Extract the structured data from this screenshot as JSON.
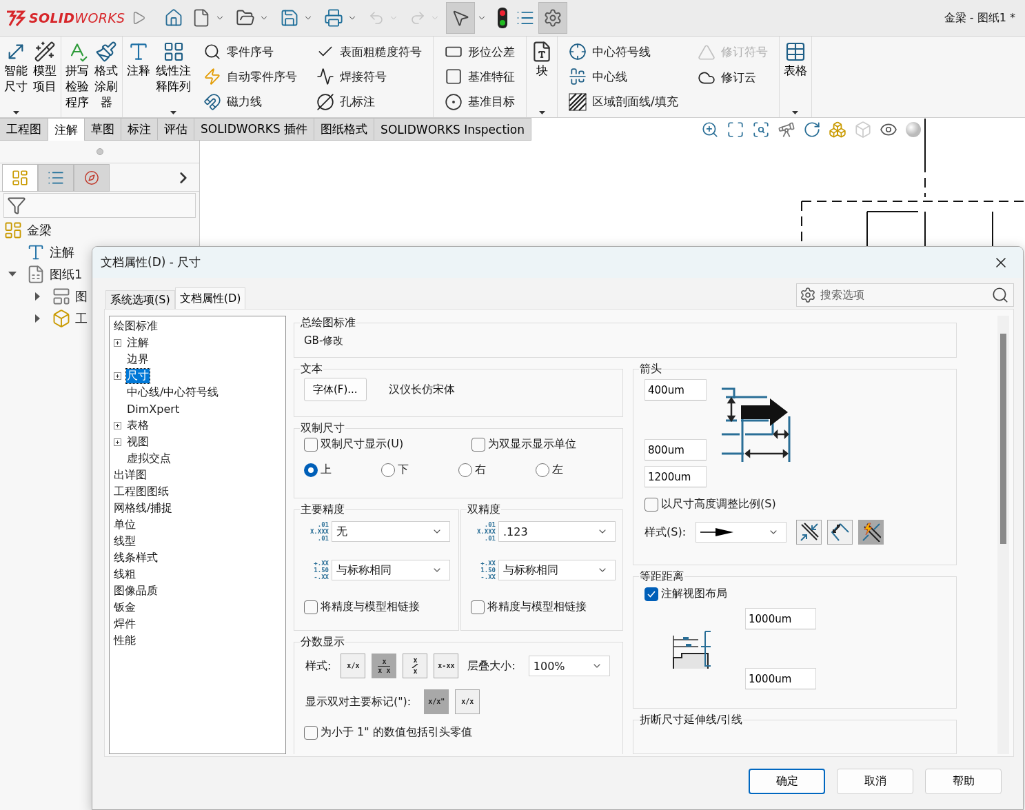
{
  "app": {
    "logo": "**SOLID**WORKS",
    "title": "金梁 - 图纸1 *"
  },
  "ribbon": [
    {
      "columns": [
        {
          "kind": "big",
          "label": "智能尺寸",
          "dropdown": true
        },
        {
          "kind": "big",
          "label": "模型项目",
          "dropdown": false
        }
      ]
    },
    {
      "columns": [
        {
          "kind": "big",
          "label": "拼写检验程序",
          "dropdown": false
        },
        {
          "kind": "big",
          "label": "格式涂刷器",
          "dropdown": false
        }
      ]
    },
    {
      "columns": [
        {
          "kind": "big",
          "label": "注释",
          "dropdown": false
        },
        {
          "kind": "big",
          "label": "线性注释阵列",
          "dropdown": true
        },
        {
          "kind": "stack",
          "items": [
            {
              "label": "零件序号",
              "disabled": false
            },
            {
              "label": "自动零件序号",
              "disabled": false
            },
            {
              "label": "磁力线",
              "disabled": false
            }
          ]
        },
        {
          "kind": "stack",
          "items": [
            {
              "label": "表面粗糙度符号",
              "disabled": false
            },
            {
              "label": "焊接符号",
              "disabled": false
            },
            {
              "label": "孔标注",
              "disabled": false
            }
          ]
        }
      ]
    },
    {
      "columns": [
        {
          "kind": "stack",
          "items": [
            {
              "label": "形位公差",
              "disabled": false
            },
            {
              "label": "基准特征",
              "disabled": false
            },
            {
              "label": "基准目标",
              "disabled": false
            }
          ]
        }
      ]
    },
    {
      "columns": [
        {
          "kind": "big",
          "label": "块",
          "dropdown": true
        }
      ]
    },
    {
      "columns": [
        {
          "kind": "stack",
          "items": [
            {
              "label": "中心符号线",
              "disabled": false
            },
            {
              "label": "中心线",
              "disabled": false
            },
            {
              "label": "区域剖面线/填充",
              "disabled": false
            }
          ]
        },
        {
          "kind": "stack",
          "items": [
            {
              "label": "修订符号",
              "disabled": true
            },
            {
              "label": "修订云",
              "disabled": false
            }
          ]
        }
      ]
    },
    {
      "columns": [
        {
          "kind": "big",
          "label": "表格",
          "dropdown": true
        }
      ]
    }
  ],
  "tabs": [
    {
      "label": "工程图",
      "selected": false
    },
    {
      "label": "注解",
      "selected": true
    },
    {
      "label": "草图",
      "selected": false
    },
    {
      "label": "标注",
      "selected": false
    },
    {
      "label": "评估",
      "selected": false
    },
    {
      "label": "SOLIDWORKS 插件",
      "selected": false
    },
    {
      "label": "图纸格式",
      "selected": false
    },
    {
      "label": "SOLIDWORKS Inspection",
      "selected": false
    }
  ],
  "panel_tabs": [
    {
      "selected": true
    },
    {
      "selected": false
    },
    {
      "selected": false
    }
  ],
  "feature_tree": [
    {
      "label": "金梁",
      "toggle": false,
      "children": [
        {
          "label": "注解",
          "toggle": false
        },
        {
          "label": "图纸1",
          "toggle": true,
          "expanded": true,
          "children": [
            {
              "label": "图",
              "toggle": true,
              "expanded": false
            },
            {
              "label": "工",
              "toggle": true,
              "expanded": false
            }
          ]
        }
      ]
    }
  ],
  "dialog": {
    "title": "文档属性(D) - 尺寸",
    "tabs": [
      {
        "label": "系统选项(S)",
        "selected": false
      },
      {
        "label": "文档属性(D)",
        "selected": true
      }
    ],
    "search": {
      "placeholder": "搜索选项"
    },
    "tree": [
      {
        "label": "绘图标准",
        "collapsed": false,
        "selected": false,
        "children": [
          {
            "label": "注解",
            "collapsed": true,
            "selected": false
          },
          {
            "label": "边界",
            "collapsed": false,
            "selected": false
          },
          {
            "label": "尺寸",
            "collapsed": true,
            "selected": true
          },
          {
            "label": "中心线/中心符号线",
            "collapsed": false,
            "selected": false
          },
          {
            "label": "DimXpert",
            "collapsed": false,
            "selected": false
          },
          {
            "label": "表格",
            "collapsed": true,
            "selected": false
          },
          {
            "label": "视图",
            "collapsed": true,
            "selected": false
          },
          {
            "label": "虚拟交点",
            "collapsed": false,
            "selected": false
          }
        ]
      },
      {
        "label": "出详图",
        "collapsed": false,
        "selected": false
      },
      {
        "label": "工程图图纸",
        "collapsed": false,
        "selected": false
      },
      {
        "label": "网格线/捕捉",
        "collapsed": false,
        "selected": false
      },
      {
        "label": "单位",
        "collapsed": false,
        "selected": false
      },
      {
        "label": "线型",
        "collapsed": false,
        "selected": false
      },
      {
        "label": "线条样式",
        "collapsed": false,
        "selected": false
      },
      {
        "label": "线粗",
        "collapsed": false,
        "selected": false
      },
      {
        "label": "图像品质",
        "collapsed": false,
        "selected": false
      },
      {
        "label": "钣金",
        "collapsed": false,
        "selected": false
      },
      {
        "label": "焊件",
        "collapsed": false,
        "selected": false
      },
      {
        "label": "性能",
        "collapsed": false,
        "selected": false
      }
    ],
    "standard": {
      "title": "总绘图标准",
      "value": "GB-修改"
    },
    "text": {
      "title": "文本",
      "button": "字体(F)...",
      "font": "汉仪长仿宋体"
    },
    "dual": {
      "title": "双制尺寸",
      "checks": [
        {
          "label": "双制尺寸显示(U)",
          "checked": false
        },
        {
          "label": "为双显示显示单位",
          "checked": false
        }
      ],
      "positions": [
        {
          "label": "上",
          "selected": true
        },
        {
          "label": "下",
          "selected": false
        },
        {
          "label": "右",
          "selected": false
        },
        {
          "label": "左",
          "selected": false
        }
      ]
    },
    "precision": [
      {
        "title": "主要精度",
        "value_sample": [
          ".01",
          "X.XXX",
          ".01"
        ],
        "value": "无",
        "tolerance_sample": [
          "+.XX",
          "1.50",
          "-.XX"
        ],
        "tolerance": "与标称相同",
        "link": {
          "label": "将精度与模型相链接",
          "checked": false
        }
      },
      {
        "title": "双精度",
        "value_sample": [
          ".01",
          "X.XXX",
          ".01"
        ],
        "value": ".123",
        "tolerance_sample": [
          "+.XX",
          "1.50",
          "-.XX"
        ],
        "tolerance": "与标称相同",
        "link": {
          "label": "将精度与模型相链接",
          "checked": false
        }
      }
    ],
    "fraction": {
      "title": "分数显示",
      "style_label": "样式:",
      "styles": [
        {
          "kind": "inline",
          "text": "x/x",
          "selected": false
        },
        {
          "kind": "stacked",
          "top": "x",
          "bottom": "x x",
          "selected": true
        },
        {
          "kind": "diagonal",
          "top": "x",
          "bottom": "x",
          "selected": false
        },
        {
          "kind": "inline",
          "text": "x-xx",
          "selected": false
        }
      ],
      "stack_label": "层叠大小:",
      "stack_size": "100%",
      "marks_label": "显示双对主要标记(\"):",
      "marks": [
        {
          "text": "x/x\"",
          "selected": true
        },
        {
          "text": "x/x",
          "selected": false
        }
      ],
      "leading_zero": {
        "label": "为小于 1\" 的数值包括引头零值",
        "checked": false
      }
    },
    "arrows": {
      "title": "箭头",
      "sizes": [
        "400um",
        "800um",
        "1200um"
      ],
      "scale": {
        "label": "以尺寸高度调整比例(S)",
        "checked": false
      },
      "style_label": "样式(S):",
      "placements": [
        {
          "selected": false
        },
        {
          "selected": false
        },
        {
          "selected": true
        }
      ]
    },
    "offset": {
      "title": "等距距离",
      "layout": {
        "label": "注解视图布局",
        "checked": true
      },
      "distances": [
        "1000um",
        "1000um"
      ]
    },
    "break": {
      "title": "折断尺寸延伸线/引线"
    },
    "buttons": [
      {
        "label": "确定",
        "default": true
      },
      {
        "label": "取消",
        "default": false
      },
      {
        "label": "帮助",
        "default": false
      }
    ]
  }
}
